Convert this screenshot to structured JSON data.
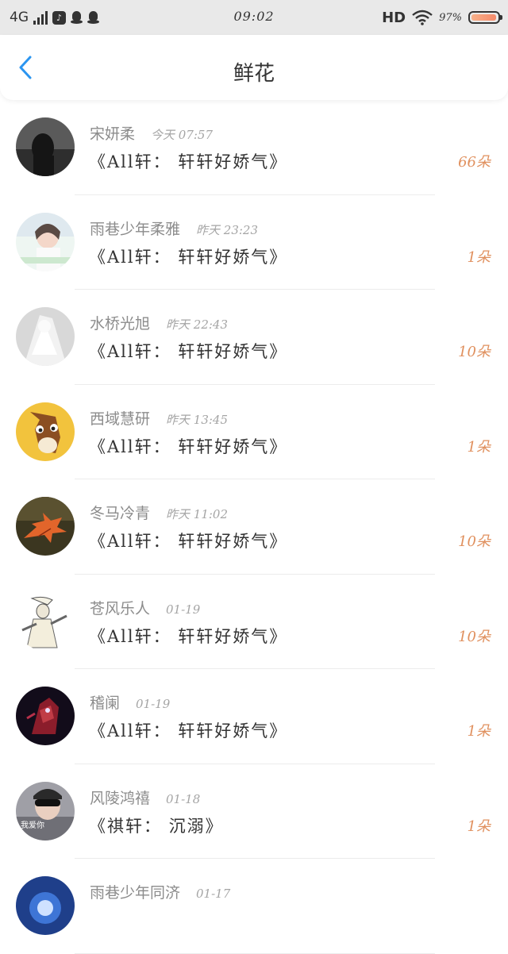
{
  "status_bar": {
    "network": "4G",
    "time": "09:02",
    "hd": "HD",
    "battery_percent": "97%",
    "battery_level": 0.97,
    "icons": [
      "signal-icon",
      "app-notification-icon",
      "qq-icon",
      "qq-icon",
      "wifi-icon",
      "battery-icon"
    ]
  },
  "navbar": {
    "back_icon": "chevron-left-icon",
    "title": "鲜花"
  },
  "colors": {
    "accent_blue": "#2b95f0",
    "count_orange": "#e0905e"
  },
  "rows": [
    {
      "name": "宋妍柔",
      "time": "今天 07:57",
      "message": "《All轩： 轩轩好娇气》",
      "count": "66朵"
    },
    {
      "name": "雨巷少年柔雅",
      "time": "昨天 23:23",
      "message": "《All轩： 轩轩好娇气》",
      "count": "1朵"
    },
    {
      "name": "水桥光旭",
      "time": "昨天 22:43",
      "message": "《All轩： 轩轩好娇气》",
      "count": "10朵"
    },
    {
      "name": "西域慧研",
      "time": "昨天 13:45",
      "message": "《All轩： 轩轩好娇气》",
      "count": "1朵"
    },
    {
      "name": "冬马冷青",
      "time": "昨天 11:02",
      "message": "《All轩： 轩轩好娇气》",
      "count": "10朵"
    },
    {
      "name": "苍风乐人",
      "time": "01-19",
      "message": "《All轩： 轩轩好娇气》",
      "count": "10朵"
    },
    {
      "name": "稽阑",
      "time": "01-19",
      "message": "《All轩： 轩轩好娇气》",
      "count": "1朵"
    },
    {
      "name": "风陵鸿禧",
      "time": "01-18",
      "message": "《祺轩： 沉溺》",
      "count": "1朵"
    },
    {
      "name": "雨巷少年同济",
      "time": "01-17",
      "message": "",
      "count": ""
    }
  ]
}
